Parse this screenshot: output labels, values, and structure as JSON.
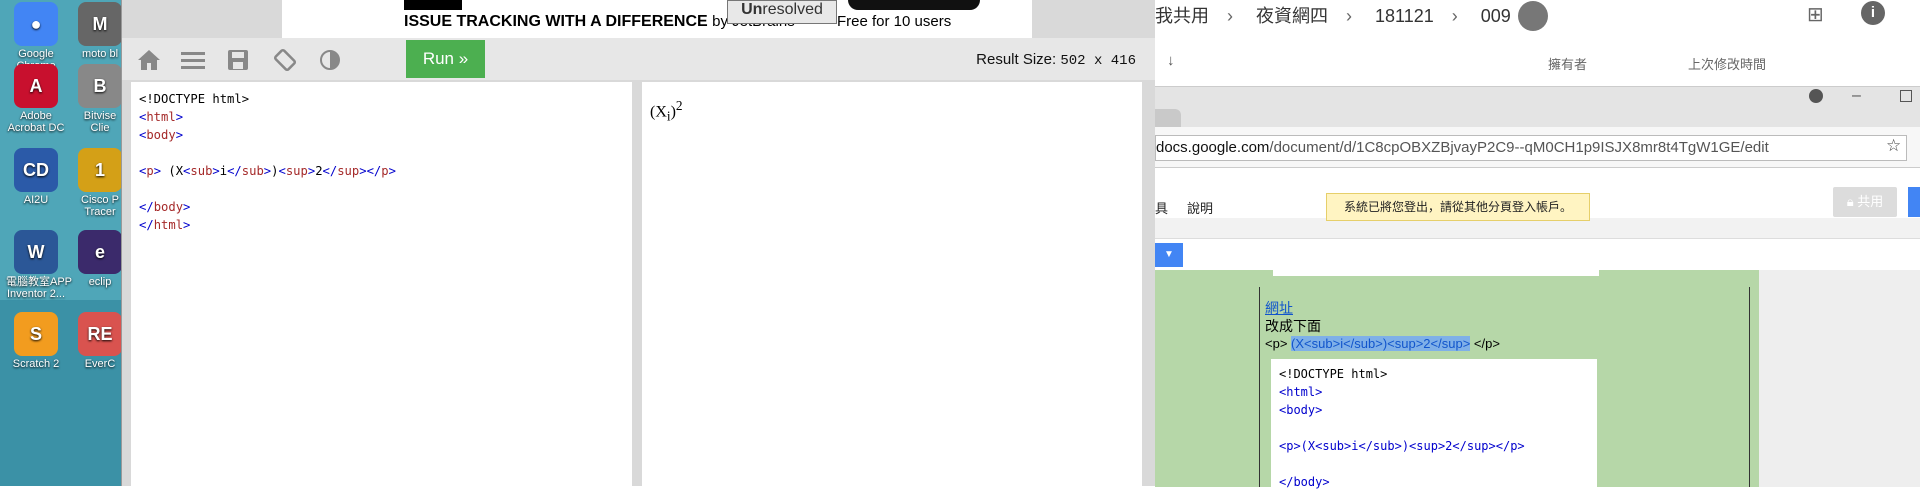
{
  "desktop": {
    "icons": [
      {
        "label": "Google\nChrome",
        "color": "#4285f4",
        "glyph": "●"
      },
      {
        "label": "moto bl",
        "color": "#666666",
        "glyph": "M"
      },
      {
        "label": "Adobe\nAcrobat DC",
        "color": "#c8102e",
        "glyph": "A"
      },
      {
        "label": "Bitvise\nClie",
        "color": "#888888",
        "glyph": "B"
      },
      {
        "label": "AI2U",
        "color": "#2b5aa8",
        "glyph": "CD"
      },
      {
        "label": "Cisco P\nTracer",
        "color": "#d4a017",
        "glyph": "1"
      },
      {
        "label": "電腦教室APP\nInventor 2...",
        "color": "#2b5797",
        "glyph": "W"
      },
      {
        "label": "eclip",
        "color": "#3b2a6b",
        "glyph": "e"
      },
      {
        "label": "Scratch 2",
        "color": "#f29c1f",
        "glyph": "S"
      },
      {
        "label": "EverC",
        "color": "#d9534f",
        "glyph": "RE"
      }
    ]
  },
  "tryit": {
    "ad": {
      "headline": "ISSUE TRACKING WITH A DIFFERENCE",
      "by": "by JetBrains",
      "badge_prefix": "Un",
      "badge_rest": "resolved",
      "free": "Free for 10 users"
    },
    "toolbar": {
      "run_label": "Run »",
      "result_label": "Result Size:",
      "result_dims": "502 x 416"
    },
    "code_lines": [
      [
        {
          "t": "<!DOCTYPE html>",
          "c": "tk"
        }
      ],
      [
        {
          "t": "<",
          "c": "tb"
        },
        {
          "t": "html",
          "c": "tg"
        },
        {
          "t": ">",
          "c": "tb"
        }
      ],
      [
        {
          "t": "<",
          "c": "tb"
        },
        {
          "t": "body",
          "c": "tg"
        },
        {
          "t": ">",
          "c": "tb"
        }
      ],
      [],
      [
        {
          "t": "<",
          "c": "tb"
        },
        {
          "t": "p",
          "c": "tg"
        },
        {
          "t": ">",
          "c": "tb"
        },
        {
          "t": " (X",
          "c": "tk"
        },
        {
          "t": "<",
          "c": "tb"
        },
        {
          "t": "sub",
          "c": "tg"
        },
        {
          "t": ">",
          "c": "tb"
        },
        {
          "t": "i",
          "c": "tk"
        },
        {
          "t": "</",
          "c": "tb"
        },
        {
          "t": "sub",
          "c": "tg"
        },
        {
          "t": ">",
          "c": "tb"
        },
        {
          "t": ")",
          "c": "tk"
        },
        {
          "t": "<",
          "c": "tb"
        },
        {
          "t": "sup",
          "c": "tg"
        },
        {
          "t": ">",
          "c": "tb"
        },
        {
          "t": "2",
          "c": "tk"
        },
        {
          "t": "</",
          "c": "tb"
        },
        {
          "t": "sup",
          "c": "tg"
        },
        {
          "t": ">",
          "c": "tb"
        },
        {
          "t": "</",
          "c": "tb"
        },
        {
          "t": "p",
          "c": "tg"
        },
        {
          "t": ">",
          "c": "tb"
        }
      ],
      [],
      [
        {
          "t": "</",
          "c": "tb"
        },
        {
          "t": "body",
          "c": "tg"
        },
        {
          "t": ">",
          "c": "tb"
        }
      ],
      [
        {
          "t": "</",
          "c": "tb"
        },
        {
          "t": "html",
          "c": "tg"
        },
        {
          "t": ">",
          "c": "tb"
        }
      ]
    ],
    "result": {
      "base": "(X",
      "sub": "i",
      "close": ")",
      "sup": "2"
    }
  },
  "drive": {
    "breadcrumb": [
      "我共用",
      "夜資網四",
      "181121",
      "009"
    ],
    "col_owner": "擁有者",
    "col_modified": "上次修改時間"
  },
  "docs": {
    "url_host": "docs.google.com",
    "url_path": "/document/d/1C8cpOBXZBjvayP2C9--qM0CH1p9ISJX8mr8t4TgW1GE/edit",
    "menu_items": [
      "具",
      "說明"
    ],
    "notice": "系統已將您登出，請從其他分頁登入帳戶。",
    "share_label": "共用",
    "link_text": "網址",
    "change_text": "改成下面",
    "p_open": "<p>",
    "highlight": "(X<sub>i</sub>)<sup>2</sup>",
    "p_close": " </p>",
    "code_lines": [
      "<!DOCTYPE html>",
      "<html>",
      "<body>",
      "",
      "<p>(X<sub>i</sub>)<sup>2</sup></p>",
      "",
      "</body>"
    ]
  }
}
